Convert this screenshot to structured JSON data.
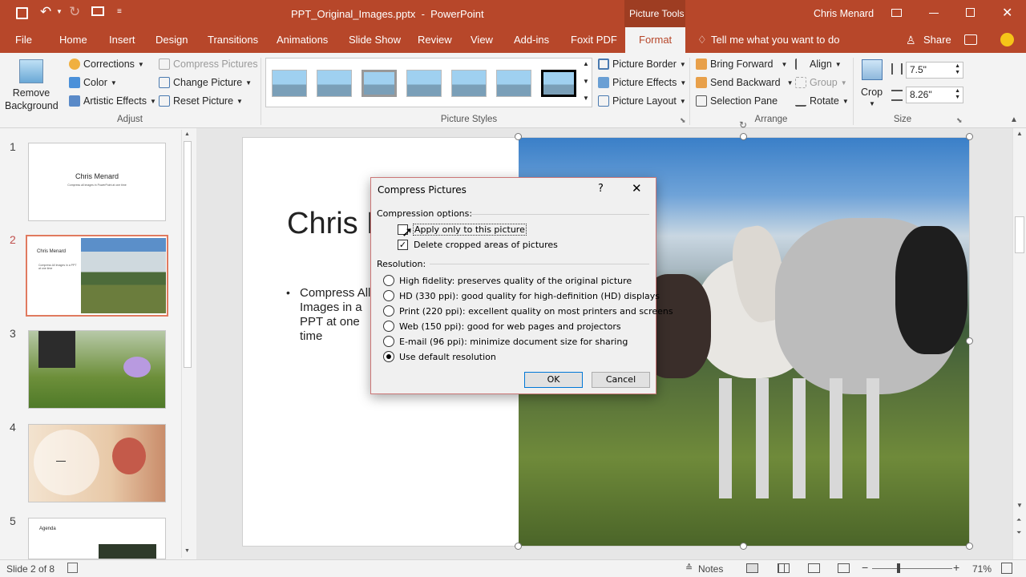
{
  "window": {
    "title": "PPT_Original_Images.pptx  -  PowerPoint",
    "context_tab": "Picture Tools",
    "user": "Chris Menard"
  },
  "tabs": [
    "File",
    "Home",
    "Insert",
    "Design",
    "Transitions",
    "Animations",
    "Slide Show",
    "Review",
    "View",
    "Add-ins",
    "Foxit PDF",
    "Format"
  ],
  "tell_me": "Tell me what you want to do",
  "share": "Share",
  "ribbon": {
    "remove_bg": "Remove Background",
    "adjust": {
      "corrections": "Corrections",
      "color": "Color",
      "artistic": "Artistic Effects",
      "compress": "Compress Pictures",
      "change": "Change Picture",
      "reset": "Reset Picture",
      "label": "Adjust"
    },
    "styles_label": "Picture Styles",
    "picture_border": "Picture Border",
    "picture_effects": "Picture Effects",
    "picture_layout": "Picture Layout",
    "arrange": {
      "bring_forward": "Bring Forward",
      "send_backward": "Send Backward",
      "selection_pane": "Selection Pane",
      "align": "Align",
      "group": "Group",
      "rotate": "Rotate",
      "label": "Arrange"
    },
    "crop": "Crop",
    "size": {
      "height": "7.5\"",
      "width": "8.26\"",
      "label": "Size"
    }
  },
  "slides": [
    {
      "num": "1",
      "title": "Chris Menard",
      "sub": "Compress all images in PowerPoint at one time"
    },
    {
      "num": "2",
      "title": "Chris Menard",
      "sub": "Compress All Images in a PPT at one time"
    },
    {
      "num": "3"
    },
    {
      "num": "4"
    },
    {
      "num": "5",
      "title": "Agenda"
    }
  ],
  "slide": {
    "title": "Chris M",
    "bullet": "Compress All Images in a PPT at one time"
  },
  "dialog": {
    "title": "Compress Pictures",
    "help": "?",
    "compression_label": "Compression options:",
    "apply_only": "Apply only to this picture",
    "apply_only_checked": false,
    "delete_cropped": "Delete cropped areas of pictures",
    "delete_cropped_checked": true,
    "resolution_label": "Resolution:",
    "options": [
      {
        "label": "High fidelity: preserves quality of the original picture",
        "selected": false
      },
      {
        "label": "HD (330 ppi): good quality for high-definition (HD) displays",
        "selected": false
      },
      {
        "label": "Print (220 ppi): excellent quality on most printers and screens",
        "selected": false
      },
      {
        "label": "Web (150 ppi): good for web pages and projectors",
        "selected": false
      },
      {
        "label": "E-mail (96 ppi): minimize document size for sharing",
        "selected": false
      },
      {
        "label": "Use default resolution",
        "selected": true
      }
    ],
    "ok": "OK",
    "cancel": "Cancel"
  },
  "status": {
    "slide_of": "Slide 2 of 8",
    "notes": "Notes",
    "zoom": "71%"
  },
  "colors": {
    "accent": "#b7472a",
    "selection": "#e07a5f"
  }
}
